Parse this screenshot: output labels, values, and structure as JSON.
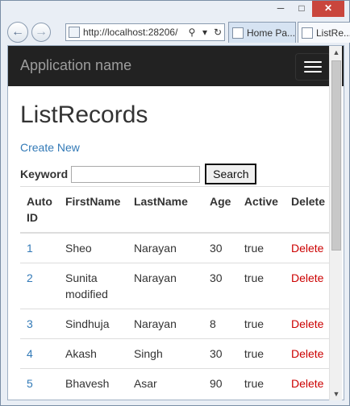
{
  "browser": {
    "url": "http://localhost:28206/",
    "tabs": [
      {
        "label": "Home Pa..."
      },
      {
        "label": "ListRe..."
      }
    ],
    "icons": {
      "back": "back-arrow-icon",
      "forward": "forward-arrow-icon",
      "search": "search-icon",
      "refresh": "refresh-icon",
      "minimize": "minimize-icon",
      "maximize": "maximize-icon",
      "close": "close-icon"
    }
  },
  "app": {
    "name": "Application name"
  },
  "page": {
    "title": "ListRecords",
    "create_link": "Create New",
    "keyword_label": "Keyword",
    "keyword_value": "",
    "search_button": "Search"
  },
  "table": {
    "headers": [
      "Auto ID",
      "FirstName",
      "LastName",
      "Age",
      "Active",
      "Delete"
    ],
    "rows": [
      {
        "id": "1",
        "first": "Sheo",
        "last": "Narayan",
        "age": "30",
        "active": "true",
        "delete": "Delete"
      },
      {
        "id": "2",
        "first": "Sunita modified",
        "last": "Narayan",
        "age": "30",
        "active": "true",
        "delete": "Delete"
      },
      {
        "id": "3",
        "first": "Sindhuja",
        "last": "Narayan",
        "age": "8",
        "active": "true",
        "delete": "Delete"
      },
      {
        "id": "4",
        "first": "Akash",
        "last": "Singh",
        "age": "30",
        "active": "true",
        "delete": "Delete"
      },
      {
        "id": "5",
        "first": "Bhavesh",
        "last": "Asar",
        "age": "90",
        "active": "true",
        "delete": "Delete"
      }
    ]
  },
  "colors": {
    "navbar": "#222222",
    "link": "#337ab7",
    "delete": "#cc0000",
    "close_button": "#c9463d"
  }
}
